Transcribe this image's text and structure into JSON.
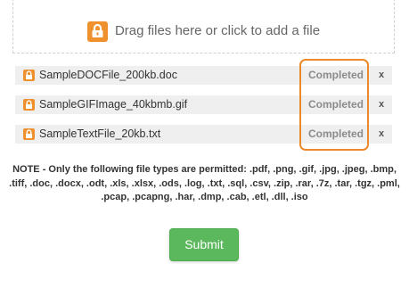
{
  "dropzone": {
    "icon": "lock-icon",
    "text": "Drag files here or click to add a file"
  },
  "files": [
    {
      "icon": "lock-icon",
      "name": "SampleDOCFile_200kb.doc",
      "status": "Completed",
      "remove_label": "x"
    },
    {
      "icon": "lock-icon",
      "name": "SampleGIFImage_40kbmb.gif",
      "status": "Completed",
      "remove_label": "x"
    },
    {
      "icon": "lock-icon",
      "name": "SampleTextFile_20kb.txt",
      "status": "Completed",
      "remove_label": "x"
    }
  ],
  "note": "NOTE - Only the following file types are permitted: .pdf, .png, .gif, .jpg, .jpeg, .bmp, .tiff, .doc, .docx, .odt, .xls, .xlsx, .ods, .log, .txt, .sql, .csv, .zip, .rar, .7z, .tar, .tgz, .pml, .pcap, .pcapng, .har, .dmp, .cab, .etl, .dll, .iso",
  "submit_label": "Submit",
  "colors": {
    "accent_orange": "#f0912f",
    "highlight_orange": "#ec8a2a",
    "submit_green": "#5cb85c",
    "row_bg": "#efefef",
    "status_gray": "#8b8b8b"
  }
}
